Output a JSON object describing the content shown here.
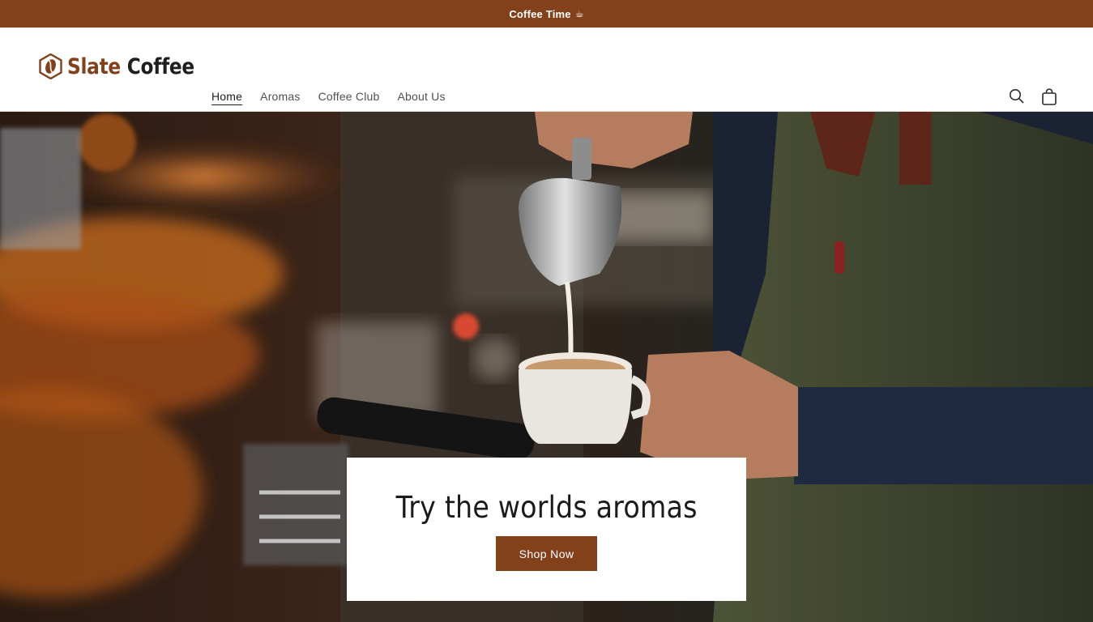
{
  "announcement": {
    "text": "Coffee Time",
    "icon": "coffee-cup-icon"
  },
  "brand": {
    "name_part1": "Slate",
    "name_part2": "Coffee",
    "accent": "#83411b"
  },
  "nav": {
    "items": [
      {
        "label": "Home",
        "active": true
      },
      {
        "label": "Aromas",
        "active": false
      },
      {
        "label": "Coffee Club",
        "active": false
      },
      {
        "label": "About Us",
        "active": false
      }
    ]
  },
  "header_icons": {
    "search": "search-icon",
    "cart": "cart-icon"
  },
  "hero": {
    "heading": "Try the worlds aromas",
    "cta_label": "Shop Now"
  }
}
